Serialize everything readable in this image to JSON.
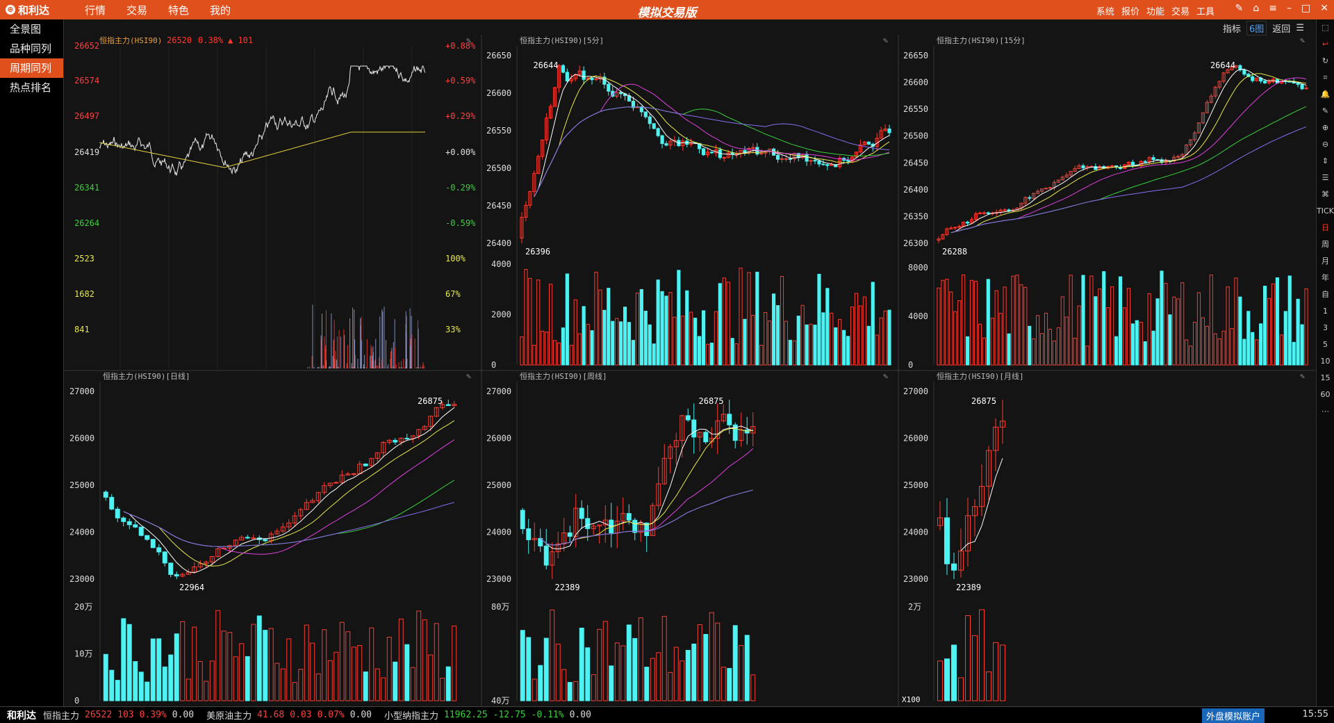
{
  "app": {
    "logo": "和利达",
    "title": "模拟交易版",
    "menu": [
      "行情",
      "交易",
      "特色",
      "我的"
    ],
    "sysmenu": [
      "系统",
      "报价",
      "功能",
      "交易",
      "工具"
    ]
  },
  "nav": [
    {
      "label": "全景图"
    },
    {
      "label": "品种同列"
    },
    {
      "label": "周期同列",
      "active": true
    },
    {
      "label": "热点排名"
    }
  ],
  "subtoolbar": {
    "indicator": "指标",
    "layout": "6图",
    "back": "返回"
  },
  "righttools": [
    "⬚",
    "↩",
    "↻",
    "⌗",
    "🔔",
    "✎",
    "⊕",
    "⊖",
    "⇕",
    "☰",
    "⌘",
    "TICK",
    "日",
    "周",
    "月",
    "年",
    "自",
    "1",
    "3",
    "5",
    "10",
    "15",
    "60",
    "⋯"
  ],
  "charts": {
    "intraday": {
      "title": "恒指主力(HSI90)",
      "price": "26520",
      "pct": "0.38%",
      "change": "▲ 101",
      "left_labels": [
        "26652",
        "26574",
        "26497",
        "26419",
        "26341",
        "26264",
        "2523",
        "1682",
        "841"
      ],
      "right_labels": [
        "+0.88%",
        "+0.59%",
        "+0.29%",
        "+0.00%",
        "-0.29%",
        "-0.59%",
        "100%",
        "67%",
        "33%"
      ]
    },
    "m5": {
      "title": "恒指主力(HSI90)[5分]",
      "y_labels": [
        "26650",
        "26600",
        "26550",
        "26500",
        "26450",
        "26400"
      ],
      "high": "26644",
      "low": "26396",
      "vol_labels": [
        "4000",
        "2000",
        "0"
      ]
    },
    "m15": {
      "title": "恒指主力(HSI90)[15分]",
      "y_labels": [
        "26650",
        "26600",
        "26550",
        "26500",
        "26450",
        "26400",
        "26350",
        "26300"
      ],
      "high": "26644",
      "low": "26288",
      "vol_labels": [
        "8000",
        "4000",
        "0"
      ]
    },
    "daily": {
      "title": "恒指主力(HSI90)[日线]",
      "y_labels": [
        "27000",
        "26000",
        "25000",
        "24000",
        "23000"
      ],
      "high": "26875",
      "low": "22964",
      "vol_labels": [
        "20万",
        "10万",
        "0"
      ]
    },
    "weekly": {
      "title": "恒指主力(HSI90)[周线]",
      "y_labels": [
        "27000",
        "26000",
        "25000",
        "24000",
        "23000"
      ],
      "high": "26875",
      "low": "22389",
      "vol_labels": [
        "80万",
        "40万"
      ]
    },
    "monthly": {
      "title": "恒指主力(HSI90)[月线]",
      "y_labels": [
        "27000",
        "26000",
        "25000",
        "24000",
        "23000"
      ],
      "high": "26875",
      "low": "22389",
      "vol_labels": [
        "2万"
      ],
      "vol_mult": "X100"
    }
  },
  "status": {
    "logo": "和利达",
    "tickers": [
      {
        "name": "恒指主力",
        "price": "26522",
        "chg": "103",
        "pct": "0.39%",
        "x": "0.00",
        "dir": "up"
      },
      {
        "name": "美原油主力",
        "price": "41.68",
        "chg": "0.03",
        "pct": "0.07%",
        "x": "0.00",
        "dir": "up"
      },
      {
        "name": "小型纳指主力",
        "price": "11962.25",
        "chg": "-12.75",
        "pct": "-0.11%",
        "x": "0.00",
        "dir": "dn"
      }
    ],
    "account": "外盘模拟账户",
    "time": "15:55"
  },
  "colors": {
    "up": "#ff3b30",
    "down": "#4df2f2",
    "accent": "#e0501c"
  }
}
